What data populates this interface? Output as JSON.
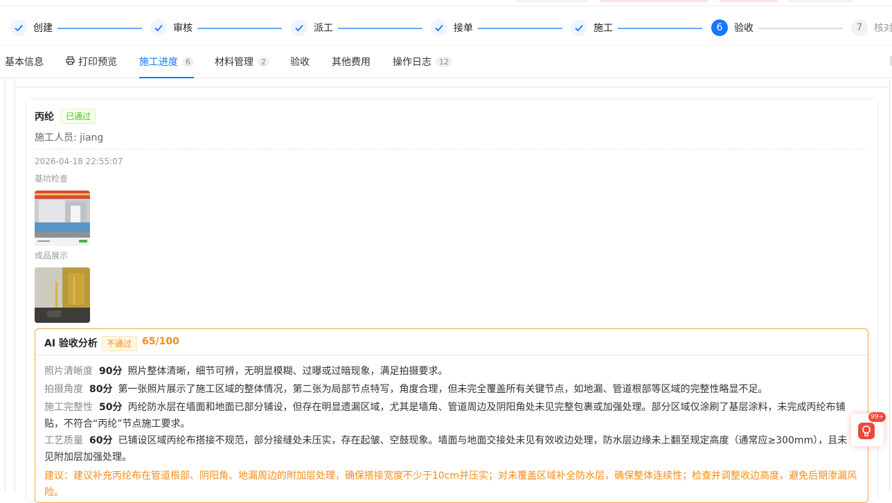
{
  "steps": [
    {
      "label": "创建",
      "state": "done"
    },
    {
      "label": "审核",
      "state": "done"
    },
    {
      "label": "派工",
      "state": "done"
    },
    {
      "label": "接单",
      "state": "done"
    },
    {
      "label": "施工",
      "state": "done"
    },
    {
      "label": "验收",
      "state": "active",
      "number": "6"
    },
    {
      "label": "核对",
      "state": "todo",
      "number": "7"
    }
  ],
  "tabs": [
    {
      "label": "基本信息"
    },
    {
      "label": "打印预览",
      "icon": "printer-icon"
    },
    {
      "label": "施工进度",
      "count": "6",
      "active": true
    },
    {
      "label": "材料管理",
      "count": "2"
    },
    {
      "label": "验收"
    },
    {
      "label": "其他费用"
    },
    {
      "label": "操作日志",
      "count": "12"
    }
  ],
  "record": {
    "title": "丙纶",
    "status": "已通过",
    "worker": "施工人员: jiang",
    "timestamp": "2026-04-18 22:55:07",
    "sections": [
      {
        "label": "基坑检查",
        "photo": "construction-site-photo"
      },
      {
        "label": "成品展示",
        "photo": "finished-work-photo"
      }
    ]
  },
  "ai": {
    "title": "AI 验收分析",
    "status": "不通过",
    "score": "65/100",
    "items": [
      {
        "label": "照片清晰度",
        "score": "90分",
        "text": "照片整体清晰，细节可辨，无明显模糊、过曝或过暗现象，满足拍摄要求。"
      },
      {
        "label": "拍摄角度",
        "score": "80分",
        "text": "第一张照片展示了施工区域的整体情况，第二张为局部节点特写，角度合理，但未完全覆盖所有关键节点，如地漏、管道根部等区域的完整性略显不足。"
      },
      {
        "label": "施工完整性",
        "score": "50分",
        "text": "丙纶防水层在墙面和地面已部分铺设，但存在明显遗漏区域，尤其是墙角、管道周边及阴阳角处未见完整包裹或加强处理。部分区域仅涂刷了基层涂料，未完成丙纶布铺贴，不符合“丙纶”节点施工要求。"
      },
      {
        "label": "工艺质量",
        "score": "60分",
        "text": "已铺设区域丙纶布搭接不规范，部分接缝处未压实，存在起皱、空鼓现象。墙面与地面交接处未见有效收边处理，防水层边缘未上翻至规定高度（通常应≥300mm），且未见附加层加强处理。"
      }
    ],
    "suggestion": "建议：建议补充丙纶布在管道根部、阴阳角、地漏周边的附加层处理，确保搭接宽度不少于10cm并压实；对未覆盖区域补全防水层，确保整体连续性；检查并调整收边高度，避免后期渗漏风险。"
  },
  "floating": {
    "count": "99+",
    "icon": "lightbulb-icon"
  },
  "colors": {
    "primary": "#1677ff",
    "success": "#52c41a",
    "warning": "#fa8c16",
    "danger": "#f0473c"
  }
}
